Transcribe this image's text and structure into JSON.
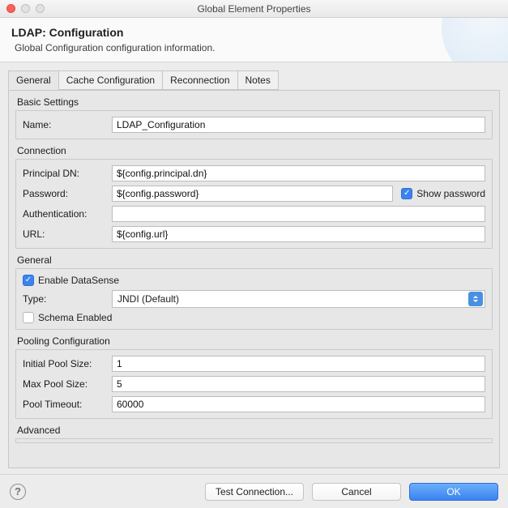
{
  "window": {
    "title": "Global Element Properties"
  },
  "header": {
    "title": "LDAP: Configuration",
    "subtitle": "Global Configuration configuration information."
  },
  "tabs": {
    "general": "General",
    "cache": "Cache Configuration",
    "reconnection": "Reconnection",
    "notes": "Notes"
  },
  "groups": {
    "basic": {
      "label": "Basic Settings",
      "name_label": "Name:",
      "name_value": "LDAP_Configuration"
    },
    "connection": {
      "label": "Connection",
      "principal_label": "Principal DN:",
      "principal_value": "${config.principal.dn}",
      "password_label": "Password:",
      "password_value": "${config.password}",
      "show_password": "Show password",
      "auth_label": "Authentication:",
      "auth_value": "",
      "url_label": "URL:",
      "url_value": "${config.url}"
    },
    "general": {
      "label": "General",
      "enable_datasense": "Enable DataSense",
      "type_label": "Type:",
      "type_value": "JNDI (Default)",
      "schema_enabled": "Schema Enabled"
    },
    "pooling": {
      "label": "Pooling Configuration",
      "initial_label": "Initial Pool Size:",
      "initial_value": "1",
      "max_label": "Max Pool Size:",
      "max_value": "5",
      "timeout_label": "Pool Timeout:",
      "timeout_value": "60000"
    },
    "advanced": {
      "label": "Advanced"
    }
  },
  "footer": {
    "test": "Test Connection...",
    "cancel": "Cancel",
    "ok": "OK"
  }
}
